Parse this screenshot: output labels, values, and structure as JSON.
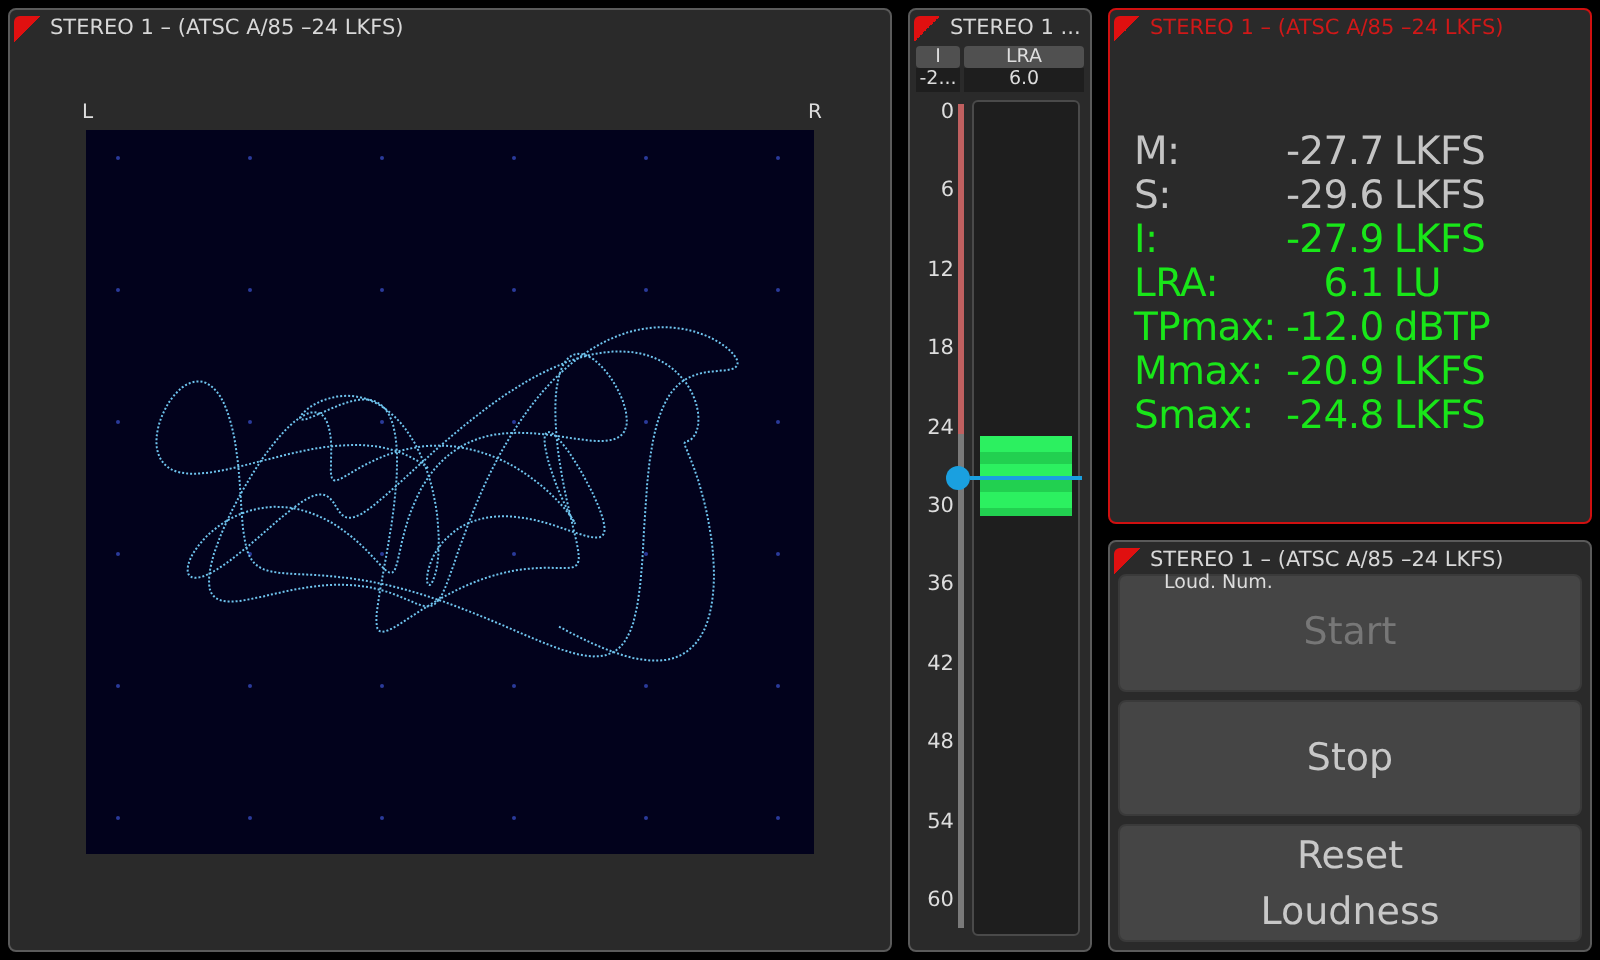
{
  "vector_panel": {
    "title": "STEREO 1 – (ATSC A/85 –24 LKFS)",
    "left_label": "L",
    "right_label": "R"
  },
  "meter_panel": {
    "title": "STEREO 1 ...",
    "tabs": [
      {
        "label": "I",
        "value": "-2..."
      },
      {
        "label": "LRA",
        "value": "6.0"
      }
    ],
    "scale": [
      "0",
      "6",
      "12",
      "18",
      "24",
      "30",
      "36",
      "42",
      "48",
      "54",
      "60"
    ],
    "indicator": {
      "level": 0.535
    }
  },
  "readout_panel": {
    "title": "STEREO 1 – (ATSC A/85 –24 LKFS)",
    "alert": true,
    "readings": [
      {
        "label": "M:",
        "value": "-27.7",
        "unit": "LKFS",
        "color": "#c4c4c4"
      },
      {
        "label": "S:",
        "value": "-29.6",
        "unit": "LKFS",
        "color": "#c4c4c4"
      },
      {
        "label": "I:",
        "value": "-27.9",
        "unit": "LKFS",
        "color": "#19e619"
      },
      {
        "label": "LRA:",
        "value": "6.1",
        "unit": "LU",
        "color": "#19e619"
      },
      {
        "label": "TPmax:",
        "value": "-12.0",
        "unit": "dBTP",
        "color": "#19e619"
      },
      {
        "label": "Mmax:",
        "value": "-20.9",
        "unit": "LKFS",
        "color": "#19e619"
      },
      {
        "label": "Smax:",
        "value": "-24.8",
        "unit": "LKFS",
        "color": "#19e619"
      }
    ]
  },
  "control_panel": {
    "title": "STEREO 1 – (ATSC A/85 –24 LKFS)",
    "caption": "Loud. Num.",
    "buttons": [
      {
        "label": "Start",
        "disabled": true
      },
      {
        "label": "Stop",
        "disabled": false
      },
      {
        "label": "Reset Loudness",
        "disabled": false
      }
    ]
  }
}
